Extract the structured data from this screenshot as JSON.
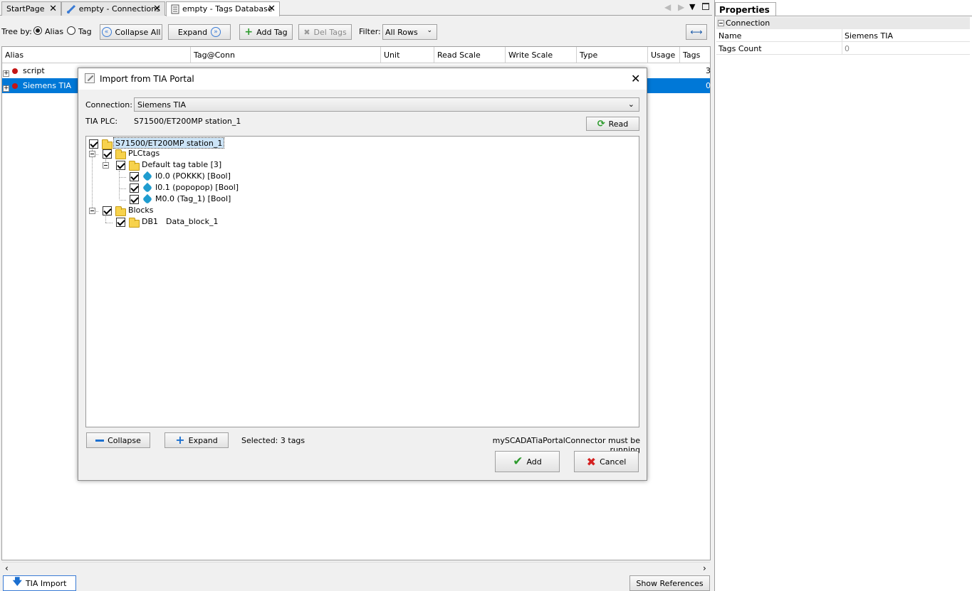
{
  "tabs": [
    {
      "label": "StartPage",
      "close": "✕"
    },
    {
      "label": "empty - Connections",
      "close": "✕"
    },
    {
      "label": "empty - Tags Database",
      "close": "✕"
    }
  ],
  "toolbar": {
    "tree_by_label": "Tree by:",
    "alias_label": "Alias",
    "tag_label": "Tag",
    "collapse_all": "Collapse All",
    "expand": "Expand",
    "add_tag": "Add Tag",
    "del_tags": "Del Tags",
    "filter_label": "Filter:",
    "filter_value": "All Rows"
  },
  "grid": {
    "columns": [
      "Alias",
      "Tag@Conn",
      "Unit",
      "Read Scale",
      "Write Scale",
      "Type",
      "Usage",
      "Tags"
    ],
    "rows": [
      {
        "alias": "script",
        "tags": "3"
      },
      {
        "alias": "Siemens TIA",
        "tags": "0"
      }
    ]
  },
  "dialog": {
    "title": "Import from TIA Portal",
    "connection_label": "Connection:",
    "connection_value": "Siemens TIA",
    "plc_label": "TIA PLC:",
    "plc_value": "S71500/ET200MP station_1",
    "read_label": "Read",
    "tree": {
      "root": "S71500/ET200MP station_1",
      "plctags": "PLCtags",
      "default_table": "Default tag table [3]",
      "tag1": "I0.0 (POKKK) [Bool]",
      "tag2": "I0.1 (popopop) [Bool]",
      "tag3": "M0.0 (Tag_1) [Bool]",
      "blocks": "Blocks",
      "db1_id": "DB1",
      "db1_name": "Data_block_1"
    },
    "collapse_label": "Collapse",
    "expand_label": "Expand",
    "selected_text": "Selected: 3 tags",
    "connector_note": "mySCADATiaPortalConnector must be running",
    "add_label": "Add",
    "cancel_label": "Cancel"
  },
  "bottom": {
    "tia_import": "TIA Import",
    "show_references": "Show References"
  },
  "properties": {
    "title": "Properties",
    "section": "Connection",
    "rows": [
      {
        "key": "Name",
        "value": "Siemens TIA"
      },
      {
        "key": "Tags Count",
        "value": "0"
      }
    ]
  },
  "colors": {
    "selection": "#0078d7",
    "tree_highlight": "#cce4f7"
  }
}
